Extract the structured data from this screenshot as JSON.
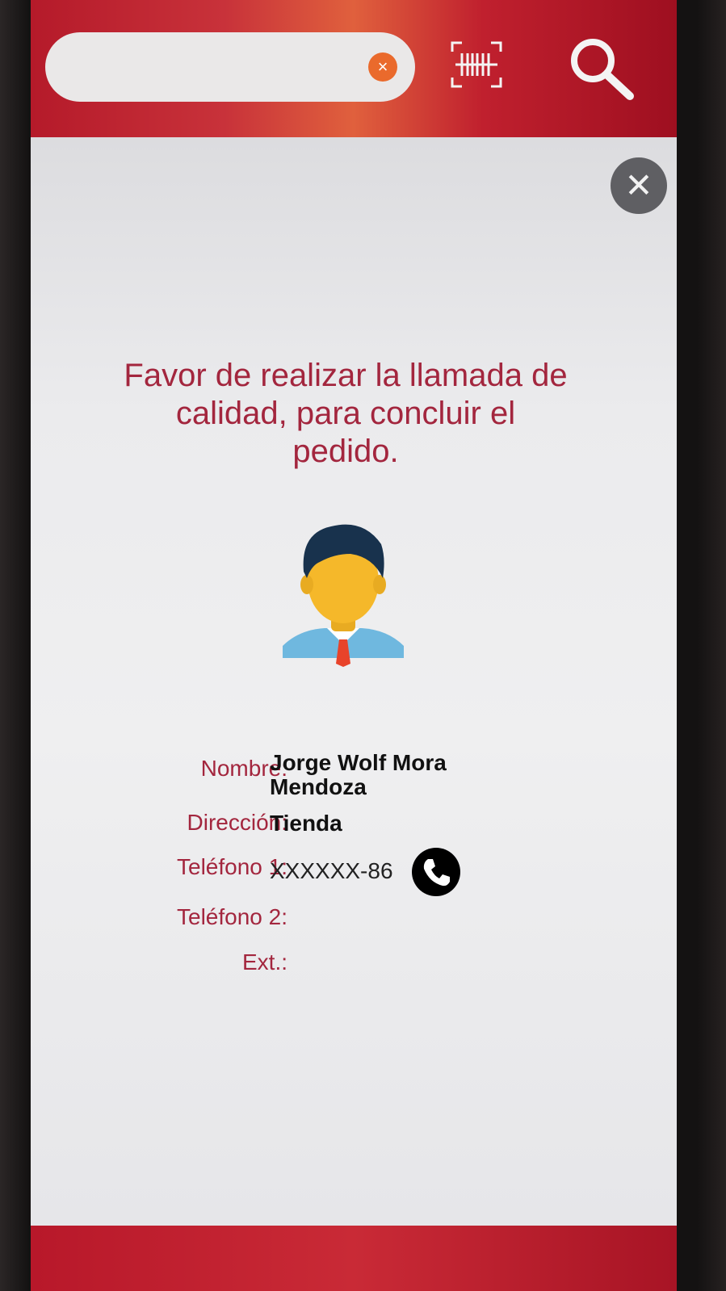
{
  "search": {
    "value": "",
    "placeholder": "",
    "clear_icon": "close-icon"
  },
  "header": {
    "barcode_icon": "barcode-scan-icon",
    "search_icon": "search-icon"
  },
  "dialog": {
    "close_icon": "close-icon",
    "message": "Favor de realizar la llamada de calidad, para concluir el pedido.",
    "avatar_icon": "person-avatar-icon"
  },
  "contact": {
    "name_label": "Nombre:",
    "name_value": "Jorge Wolf Mora Mendoza",
    "address_label": "Dirección:",
    "address_value": "Tienda",
    "phone1_label": "Teléfono 1:",
    "phone1_value": "XXXXXX-86",
    "phone2_label": "Teléfono 2:",
    "phone2_value": "",
    "ext_label": "Ext.:",
    "ext_value": "",
    "call_icon": "phone-icon"
  },
  "colors": {
    "brand": "#b51a2a",
    "label": "#a3263e",
    "clear": "#ea6a2c",
    "close_bg": "#5f5f63"
  }
}
